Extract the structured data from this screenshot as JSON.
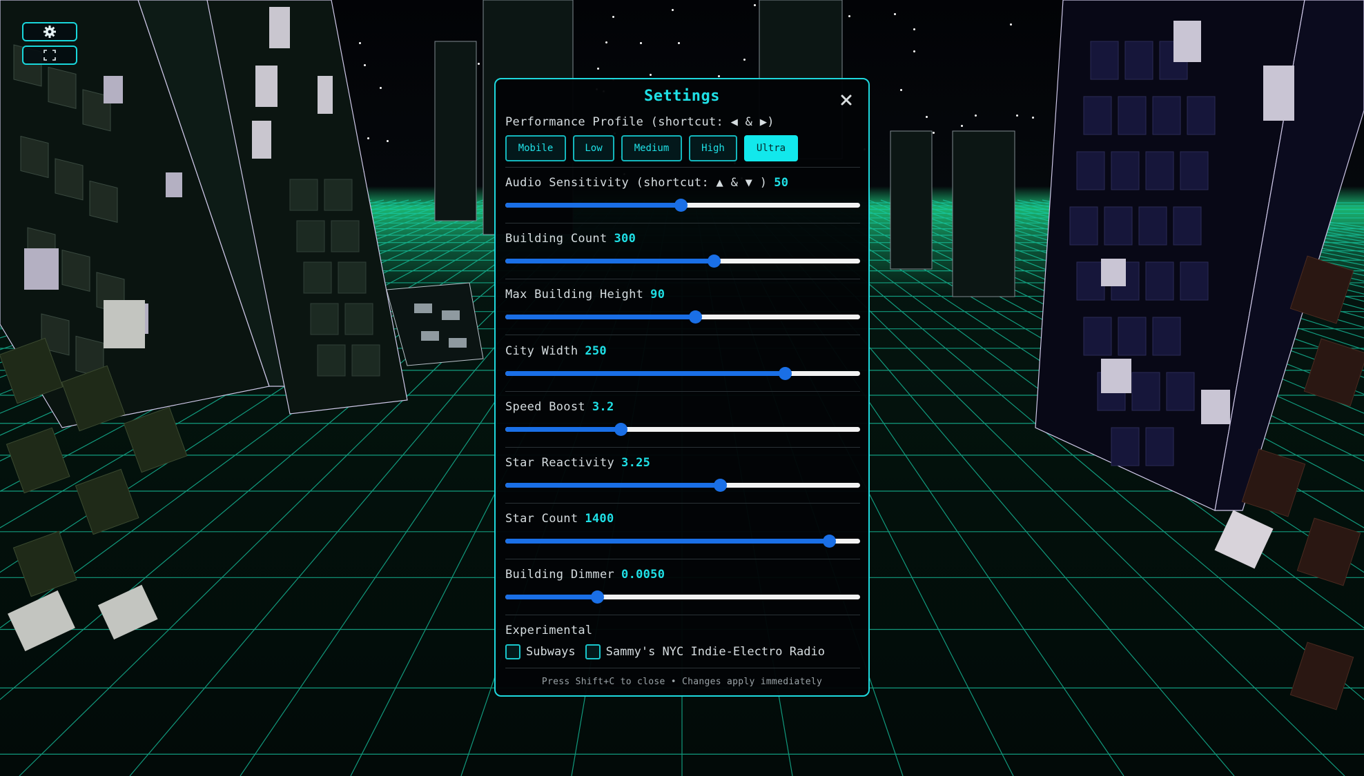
{
  "hud": {
    "settings_icon": "gear-icon",
    "fullscreen_icon": "fullscreen-icon"
  },
  "settings": {
    "title": "Settings",
    "close_icon": "close-icon",
    "performance": {
      "label": "Performance Profile (shortcut: ◀ & ▶)",
      "options": [
        "Mobile",
        "Low",
        "Medium",
        "High",
        "Ultra"
      ],
      "selected": "Ultra"
    },
    "sliders": [
      {
        "label": "Audio Sensitivity (shortcut: ▲ & ▼ )",
        "value": "50",
        "fraction": 0.495
      },
      {
        "label": "Building Count",
        "value": "300",
        "fraction": 0.588
      },
      {
        "label": "Max Building Height",
        "value": "90",
        "fraction": 0.535
      },
      {
        "label": "City Width",
        "value": "250",
        "fraction": 0.788
      },
      {
        "label": "Speed Boost",
        "value": "3.2",
        "fraction": 0.325
      },
      {
        "label": "Star Reactivity",
        "value": "3.25",
        "fraction": 0.605
      },
      {
        "label": "Star Count",
        "value": "1400",
        "fraction": 0.913
      },
      {
        "label": "Building Dimmer",
        "value": "0.0050",
        "fraction": 0.258
      }
    ],
    "experimental": {
      "label": "Experimental",
      "options": [
        {
          "label": "Subways",
          "checked": false
        },
        {
          "label": "Sammy's NYC Indie-Electro Radio",
          "checked": false
        }
      ]
    },
    "footer": "Press Shift+C to close • Changes apply immediately"
  },
  "colors": {
    "accent": "#1fe0e6",
    "slider": "#1a6fe6",
    "grid": "#17c9a4"
  }
}
